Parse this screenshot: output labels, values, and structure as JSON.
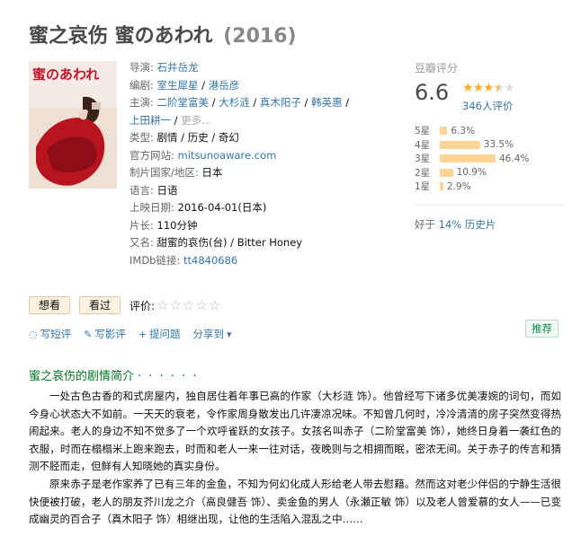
{
  "title": {
    "name": "蜜之哀伤 蜜のあわれ",
    "year": "(2016)"
  },
  "poster": {
    "alt_text": "蜜のあわれ"
  },
  "info": {
    "director_label": "导演",
    "director": "石井岳龙",
    "writer_label": "编剧",
    "writers": [
      "室生犀星",
      "港岳彦"
    ],
    "cast_label": "主演",
    "cast": [
      "二阶堂富美",
      "大杉涟",
      "真木阳子",
      "韩英惠",
      "上田耕一"
    ],
    "more": "更多...",
    "genre_label": "类型",
    "genres": [
      "剧情",
      "历史",
      "奇幻"
    ],
    "site_label": "官方网站",
    "site": "mitsunoaware.com",
    "country_label": "制片国家/地区",
    "country": "日本",
    "language_label": "语言",
    "language": "日语",
    "release_label": "上映日期",
    "release": "2016-04-01(日本)",
    "runtime_label": "片长",
    "runtime": "110分钟",
    "aka_label": "又名",
    "aka": "甜蜜的哀伤(台) / Bitter Honey",
    "imdb_label": "IMDb链接",
    "imdb": "tt4840686"
  },
  "rating": {
    "title": "豆瓣评分",
    "score": "6.6",
    "stars_filled": 3.5,
    "votes": "346人评价",
    "distribution": [
      {
        "label": "5星",
        "percent": "6.3%",
        "value": 6.3
      },
      {
        "label": "4星",
        "percent": "33.5%",
        "value": 33.5
      },
      {
        "label": "3星",
        "percent": "46.4%",
        "value": 46.4
      },
      {
        "label": "2星",
        "percent": "10.9%",
        "value": 10.9
      },
      {
        "label": "1星",
        "percent": "2.9%",
        "value": 2.9
      }
    ],
    "better_prefix": "好于",
    "better_link": "14% 历史片"
  },
  "actions": {
    "want": "想看",
    "seen": "看过",
    "rate_label": "评价:"
  },
  "tools": {
    "write_review_short": "写短评",
    "write_review": "写影评",
    "ask": "提问题",
    "share": "分享到",
    "recommend": "推荐"
  },
  "intro": {
    "title": "蜜之哀伤的剧情简介",
    "dots": "· · · · · ·",
    "p1": "一处古色古香的和式房屋内，独自居住着年事已高的作家（大杉涟 饰）。他曾经写下诸多优美凄婉的词句，而如今身心状态大不如前。一天天的衰老，令作家周身散发出几许凄凉况味。不知曾几何时，冷冷清清的房子突然变得热闹起来。老人的身边不知不觉多了一个欢呼雀跃的女孩子。女孩名叫赤子（二阶堂富美 饰），她终日身着一袭红色的衣服，时而在榻榻米上跑来跑去，时而和老人一来一往对话，夜晚则与之相拥而眠，密浓无间。关于赤子的传言和猜测不胫而走，但鲜有人知晓她的真实身份。",
    "p2": "原来赤子是老作家养了已有三年的金鱼，不知为何幻化成人形给老人带去慰藉。然而这对老少伴侣的宁静生活很快便被打破，老人的朋友芥川龙之介（高良健吾 饰）、卖金鱼的男人（永瀬正敏 饰）以及老人曾爱慕的女人——已变成幽灵的百合子（真木阳子 饰）相继出现，让他的生活陷入混乱之中……"
  }
}
